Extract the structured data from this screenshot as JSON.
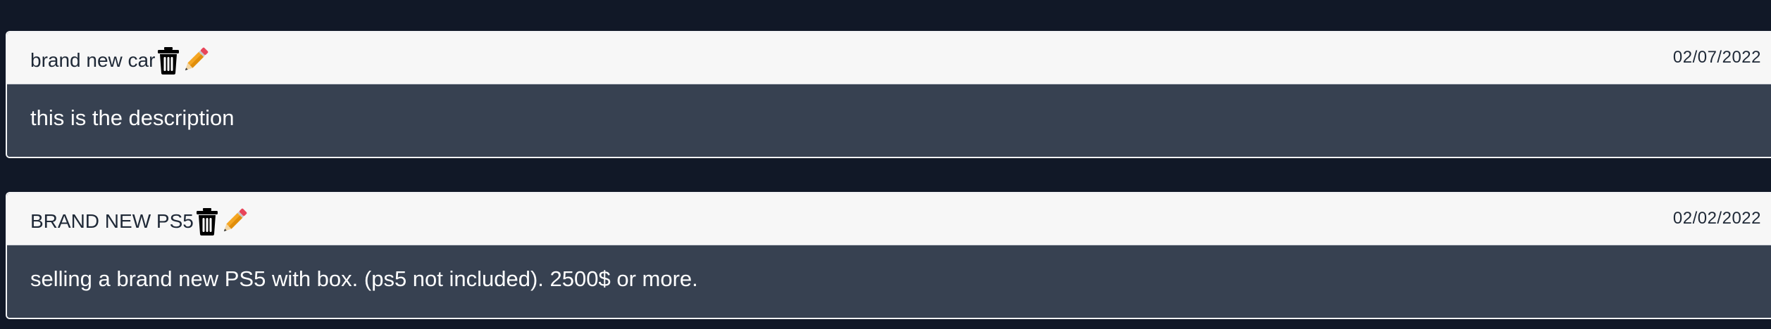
{
  "listings": [
    {
      "title": "brand new car",
      "date": "02/07/2022",
      "description": "this is the description",
      "icons": {
        "delete": "trash-icon",
        "edit": "pencil-icon"
      }
    },
    {
      "title": "BRAND NEW PS5",
      "date": "02/02/2022",
      "description": "selling a brand new PS5 with box. (ps5 not included). 2500$ or more.",
      "icons": {
        "delete": "trash-icon",
        "edit": "pencil-icon"
      }
    }
  ],
  "colors": {
    "page_background": "#111827",
    "card_header": "#f7f7f7",
    "card_body": "#374151",
    "pencil_body": "#f5a623",
    "pencil_eraser": "#e8455a"
  }
}
